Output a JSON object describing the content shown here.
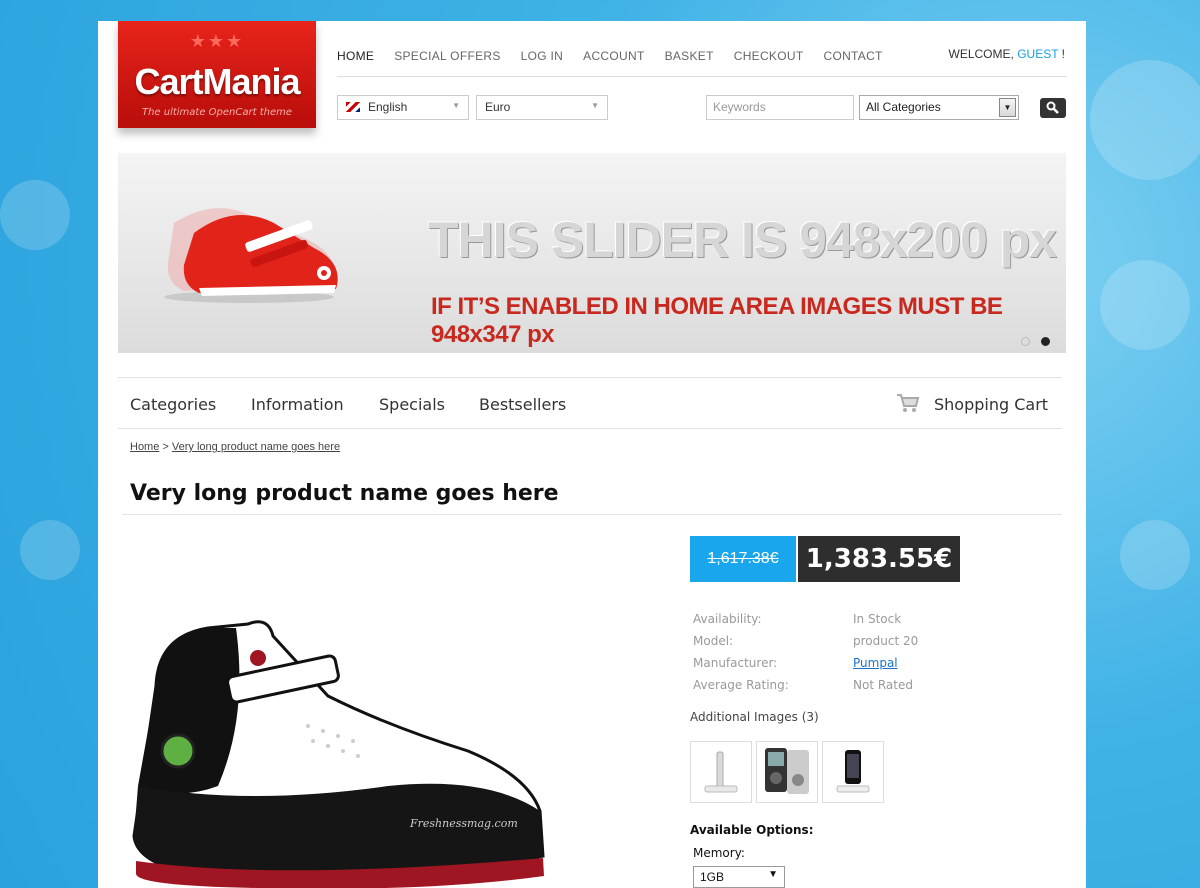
{
  "logo": {
    "name": "CartMania",
    "tagline": "The ultimate OpenCart theme",
    "stars": "★★★"
  },
  "topnav": [
    "HOME",
    "SPECIAL OFFERS",
    "LOG IN",
    "ACCOUNT",
    "BASKET",
    "CHECKOUT",
    "CONTACT"
  ],
  "welcome": {
    "prefix": "WELCOME,",
    "guest": "GUEST",
    "suffix": "!"
  },
  "language": "English",
  "currency": "Euro",
  "search": {
    "placeholder": "Keywords",
    "category": "All Categories"
  },
  "slider": {
    "title": "THIS SLIDER IS 948x200 px",
    "subtitle": "IF IT’S ENABLED IN HOME AREA IMAGES MUST BE 948x347 px"
  },
  "menu": {
    "categories": "Categories",
    "information": "Information",
    "specials": "Specials",
    "bestsellers": "Bestsellers",
    "cart": "Shopping Cart"
  },
  "breadcrumb": {
    "home": "Home",
    "sep": ">",
    "current": "Very long product name goes here"
  },
  "product": {
    "title": "Very long product name goes here",
    "old_price": "1,617.38€",
    "new_price": "1,383.55€",
    "details": [
      {
        "label": "Availability:",
        "value": "In Stock"
      },
      {
        "label": "Model:",
        "value": "product 20"
      },
      {
        "label": "Manufacturer:",
        "value": "Pumpal"
      },
      {
        "label": "Average Rating:",
        "value": "Not Rated"
      }
    ],
    "additional_images": "Additional Images (3)",
    "available_options": "Available Options:",
    "memory_label": "Memory:",
    "memory_value": "1GB",
    "image_watermark": "Freshnessmag.com"
  },
  "colors": {
    "accent": "#1aa6ec",
    "brand_red": "#d8201a",
    "dark": "#2e2e2e"
  }
}
